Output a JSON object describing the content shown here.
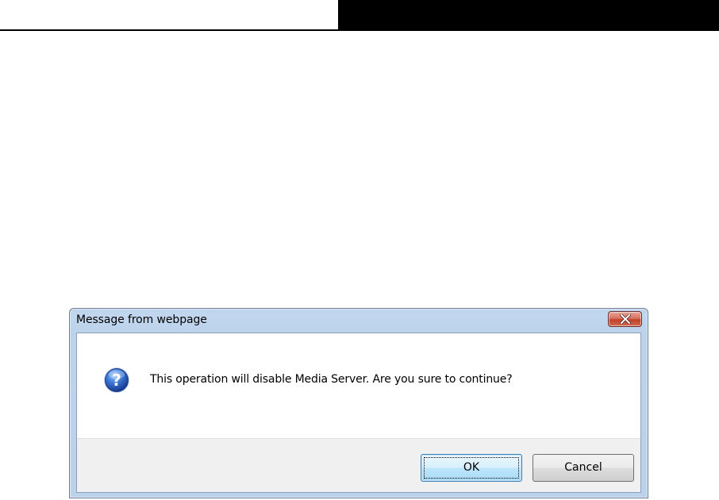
{
  "dialog": {
    "title": "Message from webpage",
    "message": "This operation will disable Media Server. Are you sure to continue?",
    "icon": "question-icon",
    "close_icon": "close-icon",
    "buttons": {
      "ok_label": "OK",
      "cancel_label": "Cancel"
    }
  },
  "colors": {
    "title_bar": "#bcd4ee",
    "close_button": "#c7432c",
    "question_icon": "#2f63b8",
    "button_bar": "#f0f0f0"
  }
}
